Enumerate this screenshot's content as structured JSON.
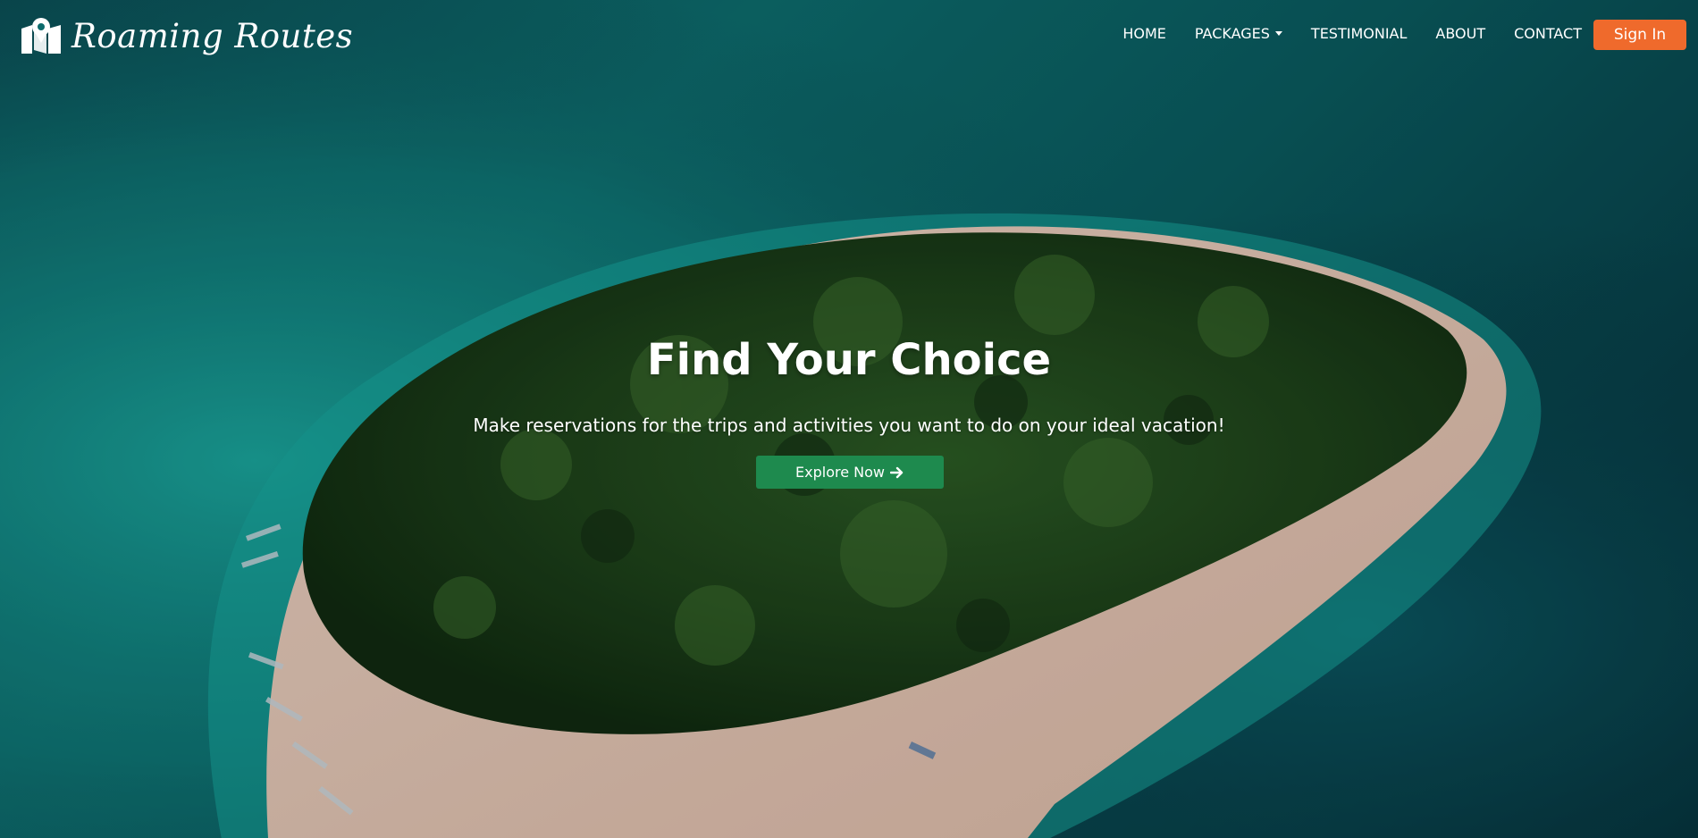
{
  "brand": {
    "name": "Roaming Routes",
    "icon": "map-marker-icon"
  },
  "nav": {
    "items": [
      {
        "label": "HOME"
      },
      {
        "label": "PACKAGES",
        "has_dropdown": true
      },
      {
        "label": "TESTIMONIAL"
      },
      {
        "label": "ABOUT"
      },
      {
        "label": "CONTACT"
      }
    ],
    "signin_label": "Sign In"
  },
  "hero": {
    "title": "Find Your Choice",
    "subtitle": "Make reservations for the trips and activities you want to do on your ideal vacation!",
    "cta_label": "Explore Now",
    "cta_icon": "arrow-right-icon"
  },
  "colors": {
    "accent_orange": "#ef6a2c",
    "cta_green": "#1e8a4e",
    "sea": "#0d6b6c",
    "forest": "#1f4a1c",
    "sand": "#e3c4b4"
  }
}
